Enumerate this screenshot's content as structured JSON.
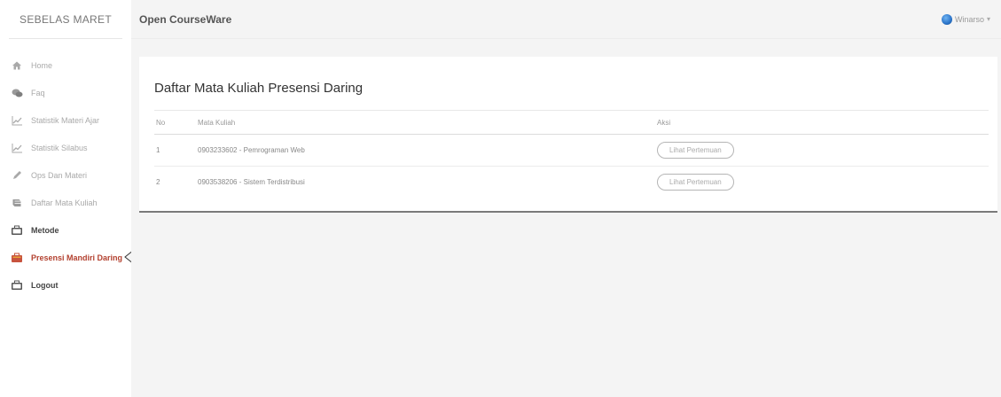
{
  "sidebar": {
    "brand": "SEBELAS MARET",
    "items": [
      {
        "label": "Home",
        "icon": "home-icon",
        "style": "muted"
      },
      {
        "label": "Faq",
        "icon": "chat-icon",
        "style": "muted"
      },
      {
        "label": "Statistik Materi Ajar",
        "icon": "chart-icon",
        "style": "muted"
      },
      {
        "label": "Statistik Silabus",
        "icon": "chart-icon",
        "style": "muted"
      },
      {
        "label": "Ops Dan Materi",
        "icon": "pencil-icon",
        "style": "muted"
      },
      {
        "label": "Daftar Mata Kuliah",
        "icon": "book-icon",
        "style": "muted"
      },
      {
        "label": "Metode",
        "icon": "briefcase-icon",
        "style": "dark"
      },
      {
        "label": "Presensi Mandiri Daring",
        "icon": "briefcase-icon",
        "style": "active"
      },
      {
        "label": "Logout",
        "icon": "briefcase-icon",
        "style": "dark"
      }
    ]
  },
  "header": {
    "title": "Open CourseWare",
    "user_name": "Winarso",
    "user_caret": "▾"
  },
  "main": {
    "heading": "Daftar Mata Kuliah Presensi Daring",
    "table": {
      "columns": [
        "No",
        "Mata Kuliah",
        "Aksi"
      ],
      "rows": [
        {
          "no": "1",
          "course": "0903233602 - Pemrograman Web",
          "action": "Lihat Pertemuan"
        },
        {
          "no": "2",
          "course": "0903538206 - Sistem Terdistribusi",
          "action": "Lihat Pertemuan"
        }
      ]
    }
  },
  "colors": {
    "active": "#b3412f",
    "muted_text": "#a9a9a9",
    "background": "#f4f4f4"
  }
}
